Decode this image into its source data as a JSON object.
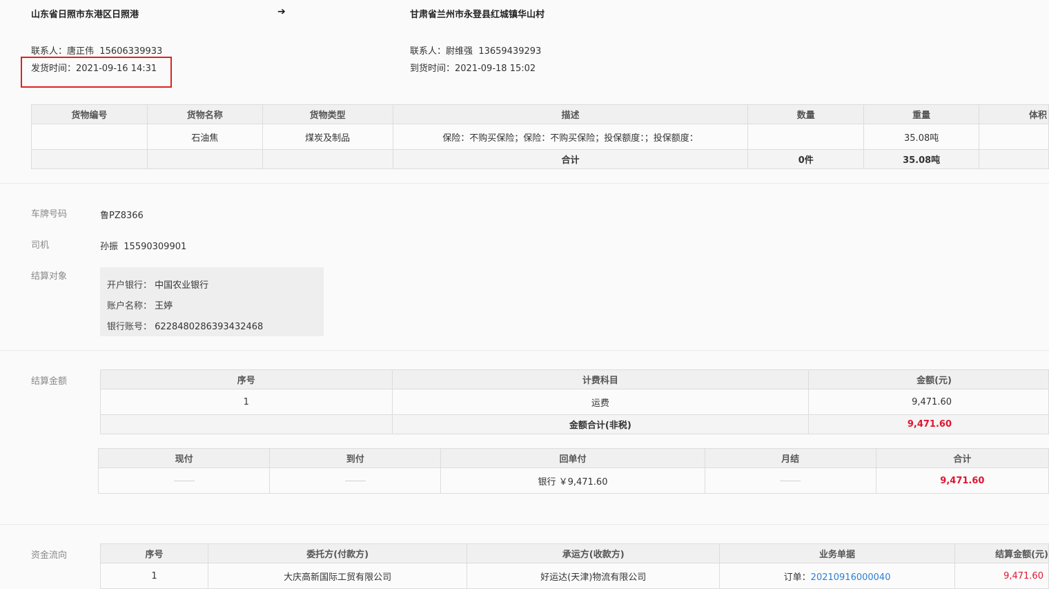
{
  "route": {
    "from": "山东省日照市东港区日照港",
    "to": "甘肃省兰州市永登县红城镇华山村",
    "arrow_icon": "arrow-right-icon"
  },
  "sender": {
    "contact_label": "联系人：",
    "contact_name": "唐正伟",
    "contact_phone": "15606339933",
    "time_label": "发货时间：",
    "time_value": "2021-09-16 14:31"
  },
  "receiver": {
    "contact_label": "联系人：",
    "contact_name": "尉维强",
    "contact_phone": "13659439293",
    "time_label": "到货时间：",
    "time_value": "2021-09-18 15:02"
  },
  "cargo": {
    "headers": [
      "货物编号",
      "货物名称",
      "货物类型",
      "描述",
      "数量",
      "重量",
      "体积"
    ],
    "row": [
      "",
      "石油焦",
      "煤炭及制品",
      "保险：不购买保险；保险：不购买保险；投保额度：；投保额度：",
      "",
      "35.08吨",
      ""
    ],
    "total": [
      "",
      "",
      "",
      "合计",
      "0件",
      "35.08吨",
      ""
    ]
  },
  "vehicle": {
    "plate_label": "车牌号码",
    "plate_value": "鲁PZ8366",
    "driver_label": "司机",
    "driver_name": "孙振",
    "driver_phone": "15590309901",
    "settle_label": "结算对象"
  },
  "bank": {
    "bank_label": "开户银行：",
    "bank_value": "中国农业银行",
    "account_name_label": "账户名称：",
    "account_name_value": "王婷",
    "account_no_label": "银行账号：",
    "account_no_value": "6228480286393432468"
  },
  "fee": {
    "section_label": "结算金额",
    "headers": [
      "序号",
      "计费科目",
      "金额(元)"
    ],
    "row": [
      "1",
      "运费",
      "9,471.60"
    ],
    "total_label": "金额合计(非税)",
    "total_value": "9,471.60"
  },
  "payment": {
    "headers": [
      "现付",
      "到付",
      "回单付",
      "月结",
      "合计"
    ],
    "receipt_pay": "银行 ￥9,471.60",
    "total": "9,471.60"
  },
  "flow": {
    "section_label": "资金流向",
    "headers": [
      "序号",
      "委托方(付款方)",
      "承运方(收款方)",
      "业务单据",
      "结算金额(元)"
    ],
    "row": {
      "index": "1",
      "payer": "大庆高新国际工贸有限公司",
      "payee": "好运达(天津)物流有限公司",
      "doc_label": "订单：",
      "doc_number": "20210916000040",
      "amount": "9,471.60"
    }
  },
  "colors": {
    "highlight_border": "#e02020",
    "amount_red": "#e0152f",
    "link_blue": "#2a7fd4"
  }
}
